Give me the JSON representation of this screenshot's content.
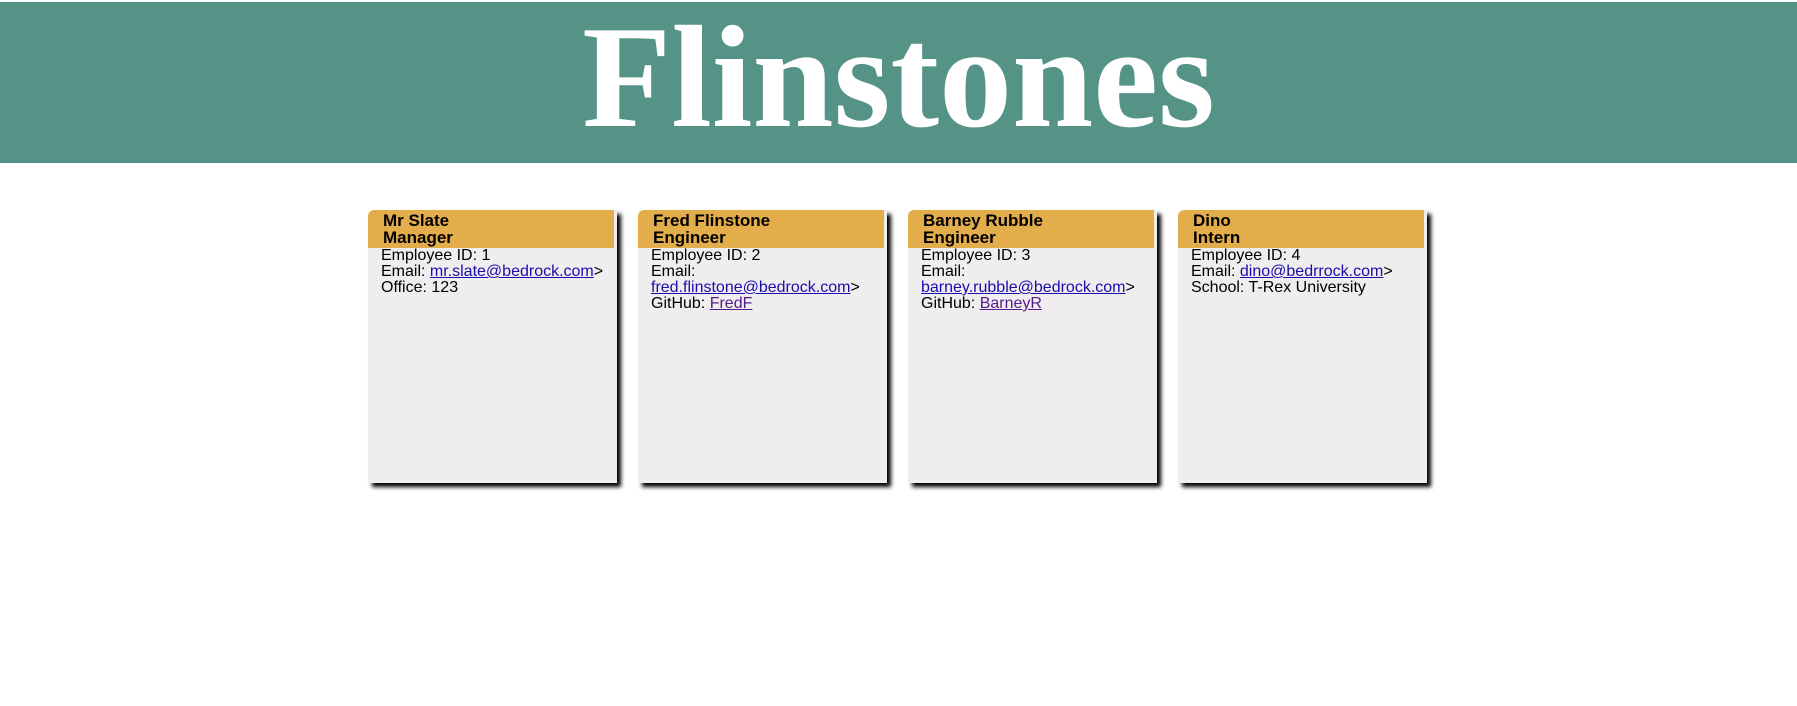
{
  "header": {
    "title": "Flinstones"
  },
  "employees": [
    {
      "name": "Mr Slate",
      "role": "Manager",
      "id_label": "Employee ID:",
      "id": "1",
      "email_label": "Email:",
      "email": "mr.slate@bedrock.com",
      "email_suffix": ">",
      "extra_label": "Office:",
      "extra_value": "123"
    },
    {
      "name": "Fred Flinstone",
      "role": "Engineer",
      "id_label": "Employee ID:",
      "id": "2",
      "email_label": "Email:",
      "email": "fred.flinstone@bedrock.com",
      "email_suffix": ">",
      "extra_label": "GitHub:",
      "extra_value": "FredF"
    },
    {
      "name": "Barney Rubble",
      "role": "Engineer",
      "id_label": "Employee ID:",
      "id": "3",
      "email_label": "Email:",
      "email": "barney.rubble@bedrock.com",
      "email_suffix": ">",
      "extra_label": "GitHub:",
      "extra_value": "BarneyR"
    },
    {
      "name": "Dino",
      "role": "Intern",
      "id_label": "Employee ID:",
      "id": "4",
      "email_label": "Email:",
      "email": "dino@bedrrock.com",
      "email_suffix": ">",
      "extra_label": "School:",
      "extra_value": "T-Rex University"
    }
  ],
  "colors": {
    "banner": "#559387",
    "card_header": "#e3ad4b",
    "card_body": "#efedee",
    "link": "#1a0dab",
    "visited_link": "#551a8b"
  }
}
